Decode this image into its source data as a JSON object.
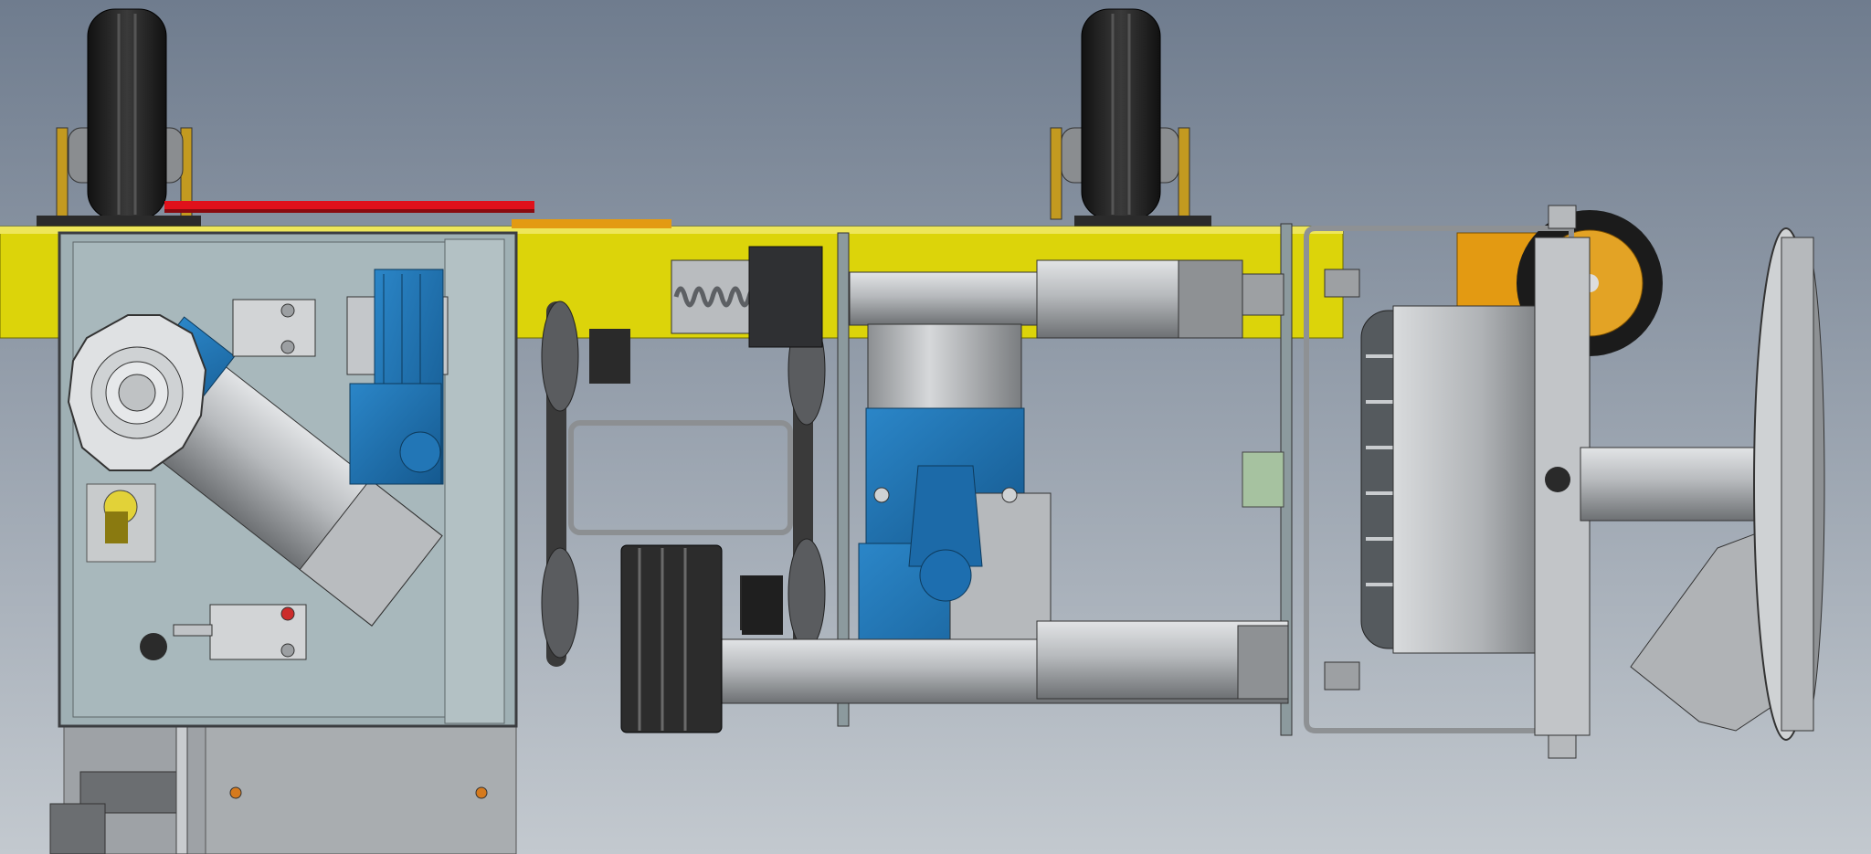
{
  "scene": {
    "subject": "cad-render-mechanical-drive-assembly",
    "colors": {
      "background_top": "#6f7c8e",
      "background_bottom": "#c3c9cf",
      "rail_yellow": "#dcd40a",
      "motor_blue": "#1f73b4",
      "steel_gray": "#b8bcc0",
      "dark_steel": "#3b3d40",
      "tire_black": "#1e1e1e",
      "orange": "#e39a12",
      "wire_red": "#e0111b",
      "panel_blue_gray": "#9fb0b4",
      "pale_green": "#a6c2a0"
    }
  }
}
